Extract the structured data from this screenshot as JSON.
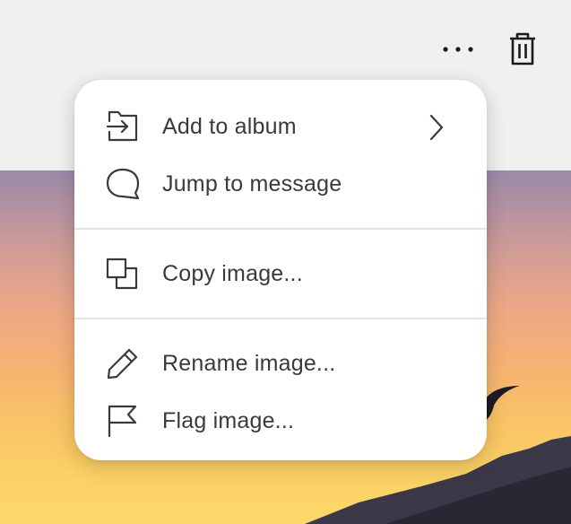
{
  "toolbar": {
    "more_icon": "more-horizontal-icon",
    "trash_icon": "trash-icon"
  },
  "menu": {
    "groups": [
      [
        {
          "label": "Add to album",
          "icon": "add-to-album-icon",
          "has_submenu": true
        },
        {
          "label": "Jump to message",
          "icon": "speech-bubble-icon"
        }
      ],
      [
        {
          "label": "Copy image...",
          "icon": "copy-icon"
        }
      ],
      [
        {
          "label": "Rename image...",
          "icon": "pencil-icon"
        },
        {
          "label": "Flag image...",
          "icon": "flag-icon"
        }
      ]
    ]
  },
  "colors": {
    "menu_background": "#ffffff",
    "text": "#3a3a3a",
    "icon": "#3a3a3a",
    "toolbar_background": "#f0f0f0"
  }
}
